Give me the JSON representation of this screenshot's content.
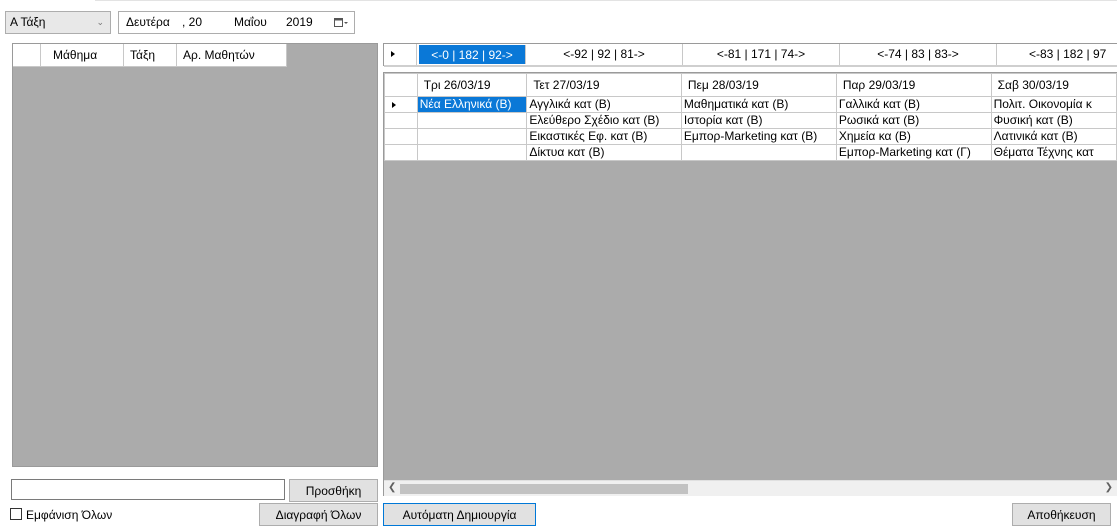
{
  "class_combo": {
    "value": "Α Τάξη"
  },
  "date_picker": {
    "weekday": "Δευτέρα",
    "day": ", 20",
    "month": "Μαΐου",
    "year": "2019"
  },
  "left_grid": {
    "columns": [
      "Μάθημα",
      "Τάξη",
      "Αρ. Μαθητών"
    ]
  },
  "week_nav": {
    "items": [
      "<-0 | 182 | 92->",
      "<-92 | 92 | 81->",
      "<-81 | 171 | 74->",
      "<-74 | 83 | 83->",
      "<-83 | 182 | 97"
    ],
    "selected_index": 0
  },
  "schedule": {
    "days": [
      "Τρι 26/03/19",
      "Τετ 27/03/19",
      "Πεμ 28/03/19",
      "Παρ 29/03/19",
      "Σαβ 30/03/19"
    ],
    "rows": [
      [
        "Νέα Ελληνικά (Β)",
        "Αγγλικά κατ (Β)",
        "Μαθηματικά κατ (Β)",
        "Γαλλικά κατ (Β)",
        "Πολιτ. Οικονομία κ"
      ],
      [
        "",
        "Ελεύθερο Σχέδιο κατ (Β)",
        "Ιστορία κατ (Β)",
        "Ρωσικά κατ (Β)",
        "Φυσική κατ (Β)"
      ],
      [
        "",
        "Εικαστικές Εφ. κατ (Β)",
        "Εμπορ-Marketing κατ (Β)",
        "Χημεία κα (Β)",
        "Λατινικά κατ (Β)"
      ],
      [
        "",
        "Δίκτυα κατ (Β)",
        "",
        "Εμπορ-Marketing κατ (Γ)",
        "Θέματα Τέχνης κατ"
      ]
    ]
  },
  "add_input": {
    "value": ""
  },
  "buttons": {
    "add": "Προσθήκη",
    "delete_all": "Διαγραφή Όλων",
    "auto_create": "Αυτόματη Δημιουργία",
    "save": "Αποθήκευση"
  },
  "show_all_checkbox": {
    "label": "Εμφάνιση Όλων",
    "checked": false
  },
  "colors": {
    "selection": "#0a78d7",
    "grid_background": "#ababab"
  }
}
